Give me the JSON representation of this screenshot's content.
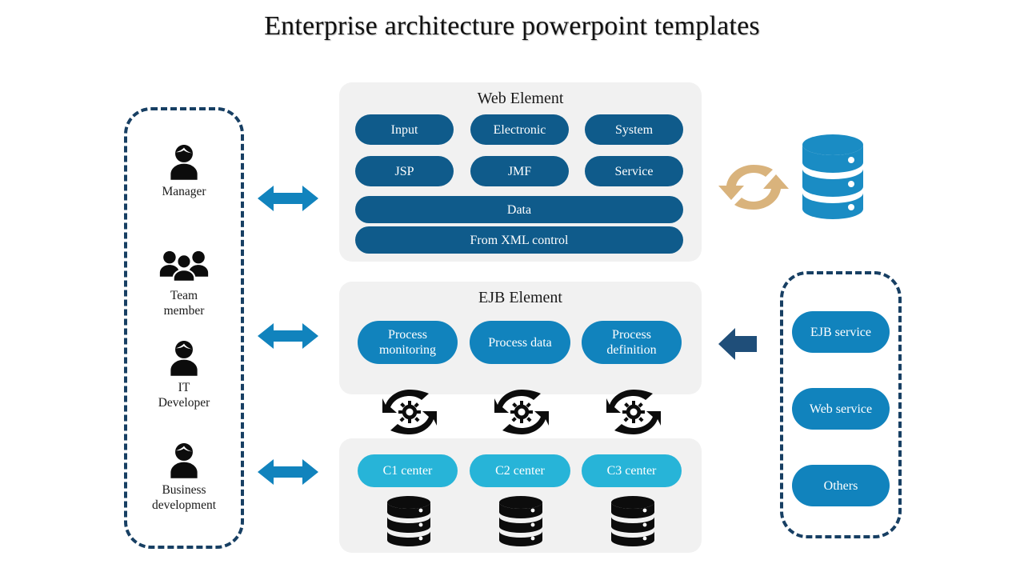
{
  "title": "Enterprise architecture powerpoint templates",
  "colors": {
    "pill_dark_blue": "#0f5b8b",
    "pill_mid_blue": "#1183bd",
    "pill_cyan": "#27b4d8",
    "dashed_border_navy": "#173f63",
    "panel_grey": "#f1f1f1",
    "sync_arrow_tan": "#d9b37c",
    "database_blue": "#1a8cc4",
    "arrow_navy": "#1f4e79",
    "icon_black": "#0c0c0c"
  },
  "actors_panel": {
    "items": [
      {
        "icon": "person-icon",
        "label": "Manager"
      },
      {
        "icon": "people-group-icon",
        "label": "Team\nmember",
        "line1": "Team",
        "line2": "member"
      },
      {
        "icon": "person-icon",
        "label": "IT\nDeveloper",
        "line1": "IT",
        "line2": "Developer"
      },
      {
        "icon": "person-icon",
        "label": "Business\ndevelopment",
        "line1": "Business",
        "line2": "development"
      }
    ]
  },
  "web_panel": {
    "title": "Web Element",
    "row1": [
      "Input",
      "Electronic",
      "System"
    ],
    "row2": [
      "JSP",
      "JMF",
      "Service"
    ],
    "wide": [
      "Data",
      "From XML control"
    ]
  },
  "ejb_panel": {
    "title": "EJB Element",
    "items": [
      {
        "line1": "Process",
        "line2": "monitoring"
      },
      {
        "line1": "Process data",
        "line2": ""
      },
      {
        "line1": "Process",
        "line2": "definition"
      }
    ],
    "gear_icons": [
      "gear-sync-icon",
      "gear-sync-icon",
      "gear-sync-icon"
    ]
  },
  "data_panel": {
    "items": [
      "C1 center",
      "C2 center",
      "C3 center"
    ],
    "database_icons": [
      "database-stack-icon",
      "database-stack-icon",
      "database-stack-icon"
    ]
  },
  "services_panel": {
    "items": [
      "EJB service",
      "Web service",
      "Others"
    ]
  },
  "connectors": {
    "manager_arrow": "double-arrow-icon",
    "team_arrow": "double-arrow-icon",
    "business_arrow": "double-arrow-icon",
    "ejb_inbound_arrow": "left-arrow-icon",
    "sync_arrows": "sync-arrows-icon",
    "top_database": "database-stack-blue-icon"
  }
}
